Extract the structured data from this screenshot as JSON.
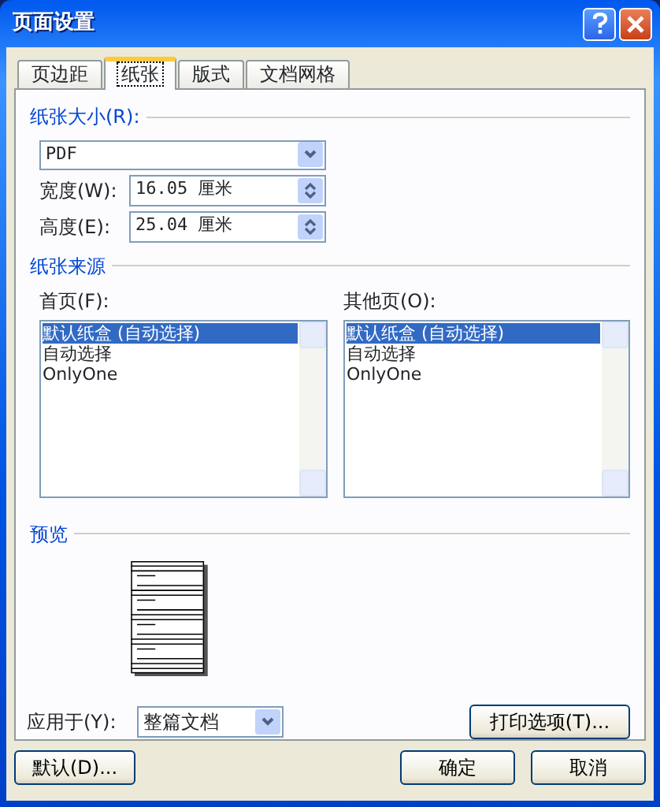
{
  "window": {
    "title": "页面设置"
  },
  "tabs": [
    {
      "label": "页边距",
      "selected": false
    },
    {
      "label": "纸张",
      "selected": true
    },
    {
      "label": "版式",
      "selected": false
    },
    {
      "label": "文档网格",
      "selected": false
    }
  ],
  "paper_size": {
    "heading": "纸张大小(R):",
    "dropdown": "PDF",
    "width": {
      "label": "宽度(W):",
      "value": "16.05 厘米"
    },
    "height": {
      "label": "高度(E):",
      "value": "25.04 厘米"
    }
  },
  "paper_source": {
    "heading": "纸张来源",
    "lists": [
      {
        "label": "首页(F):",
        "items": [
          {
            "label": "默认纸盒 (自动选择)",
            "selected": true
          },
          {
            "label": "自动选择",
            "selected": false
          },
          {
            "label": "OnlyOne",
            "selected": false
          }
        ]
      },
      {
        "label": "其他页(O):",
        "items": [
          {
            "label": "默认纸盒 (自动选择)",
            "selected": true
          },
          {
            "label": "自动选择",
            "selected": false
          },
          {
            "label": "OnlyOne",
            "selected": false
          }
        ]
      }
    ]
  },
  "preview": {
    "heading": "预览",
    "apply_to": {
      "label": "应用于(Y):",
      "value": "整篇文档"
    },
    "print_options_button": "打印选项(T)..."
  },
  "footer": {
    "left_button": "默认(D)...",
    "right_buttons": [
      "确定",
      "取消"
    ]
  }
}
